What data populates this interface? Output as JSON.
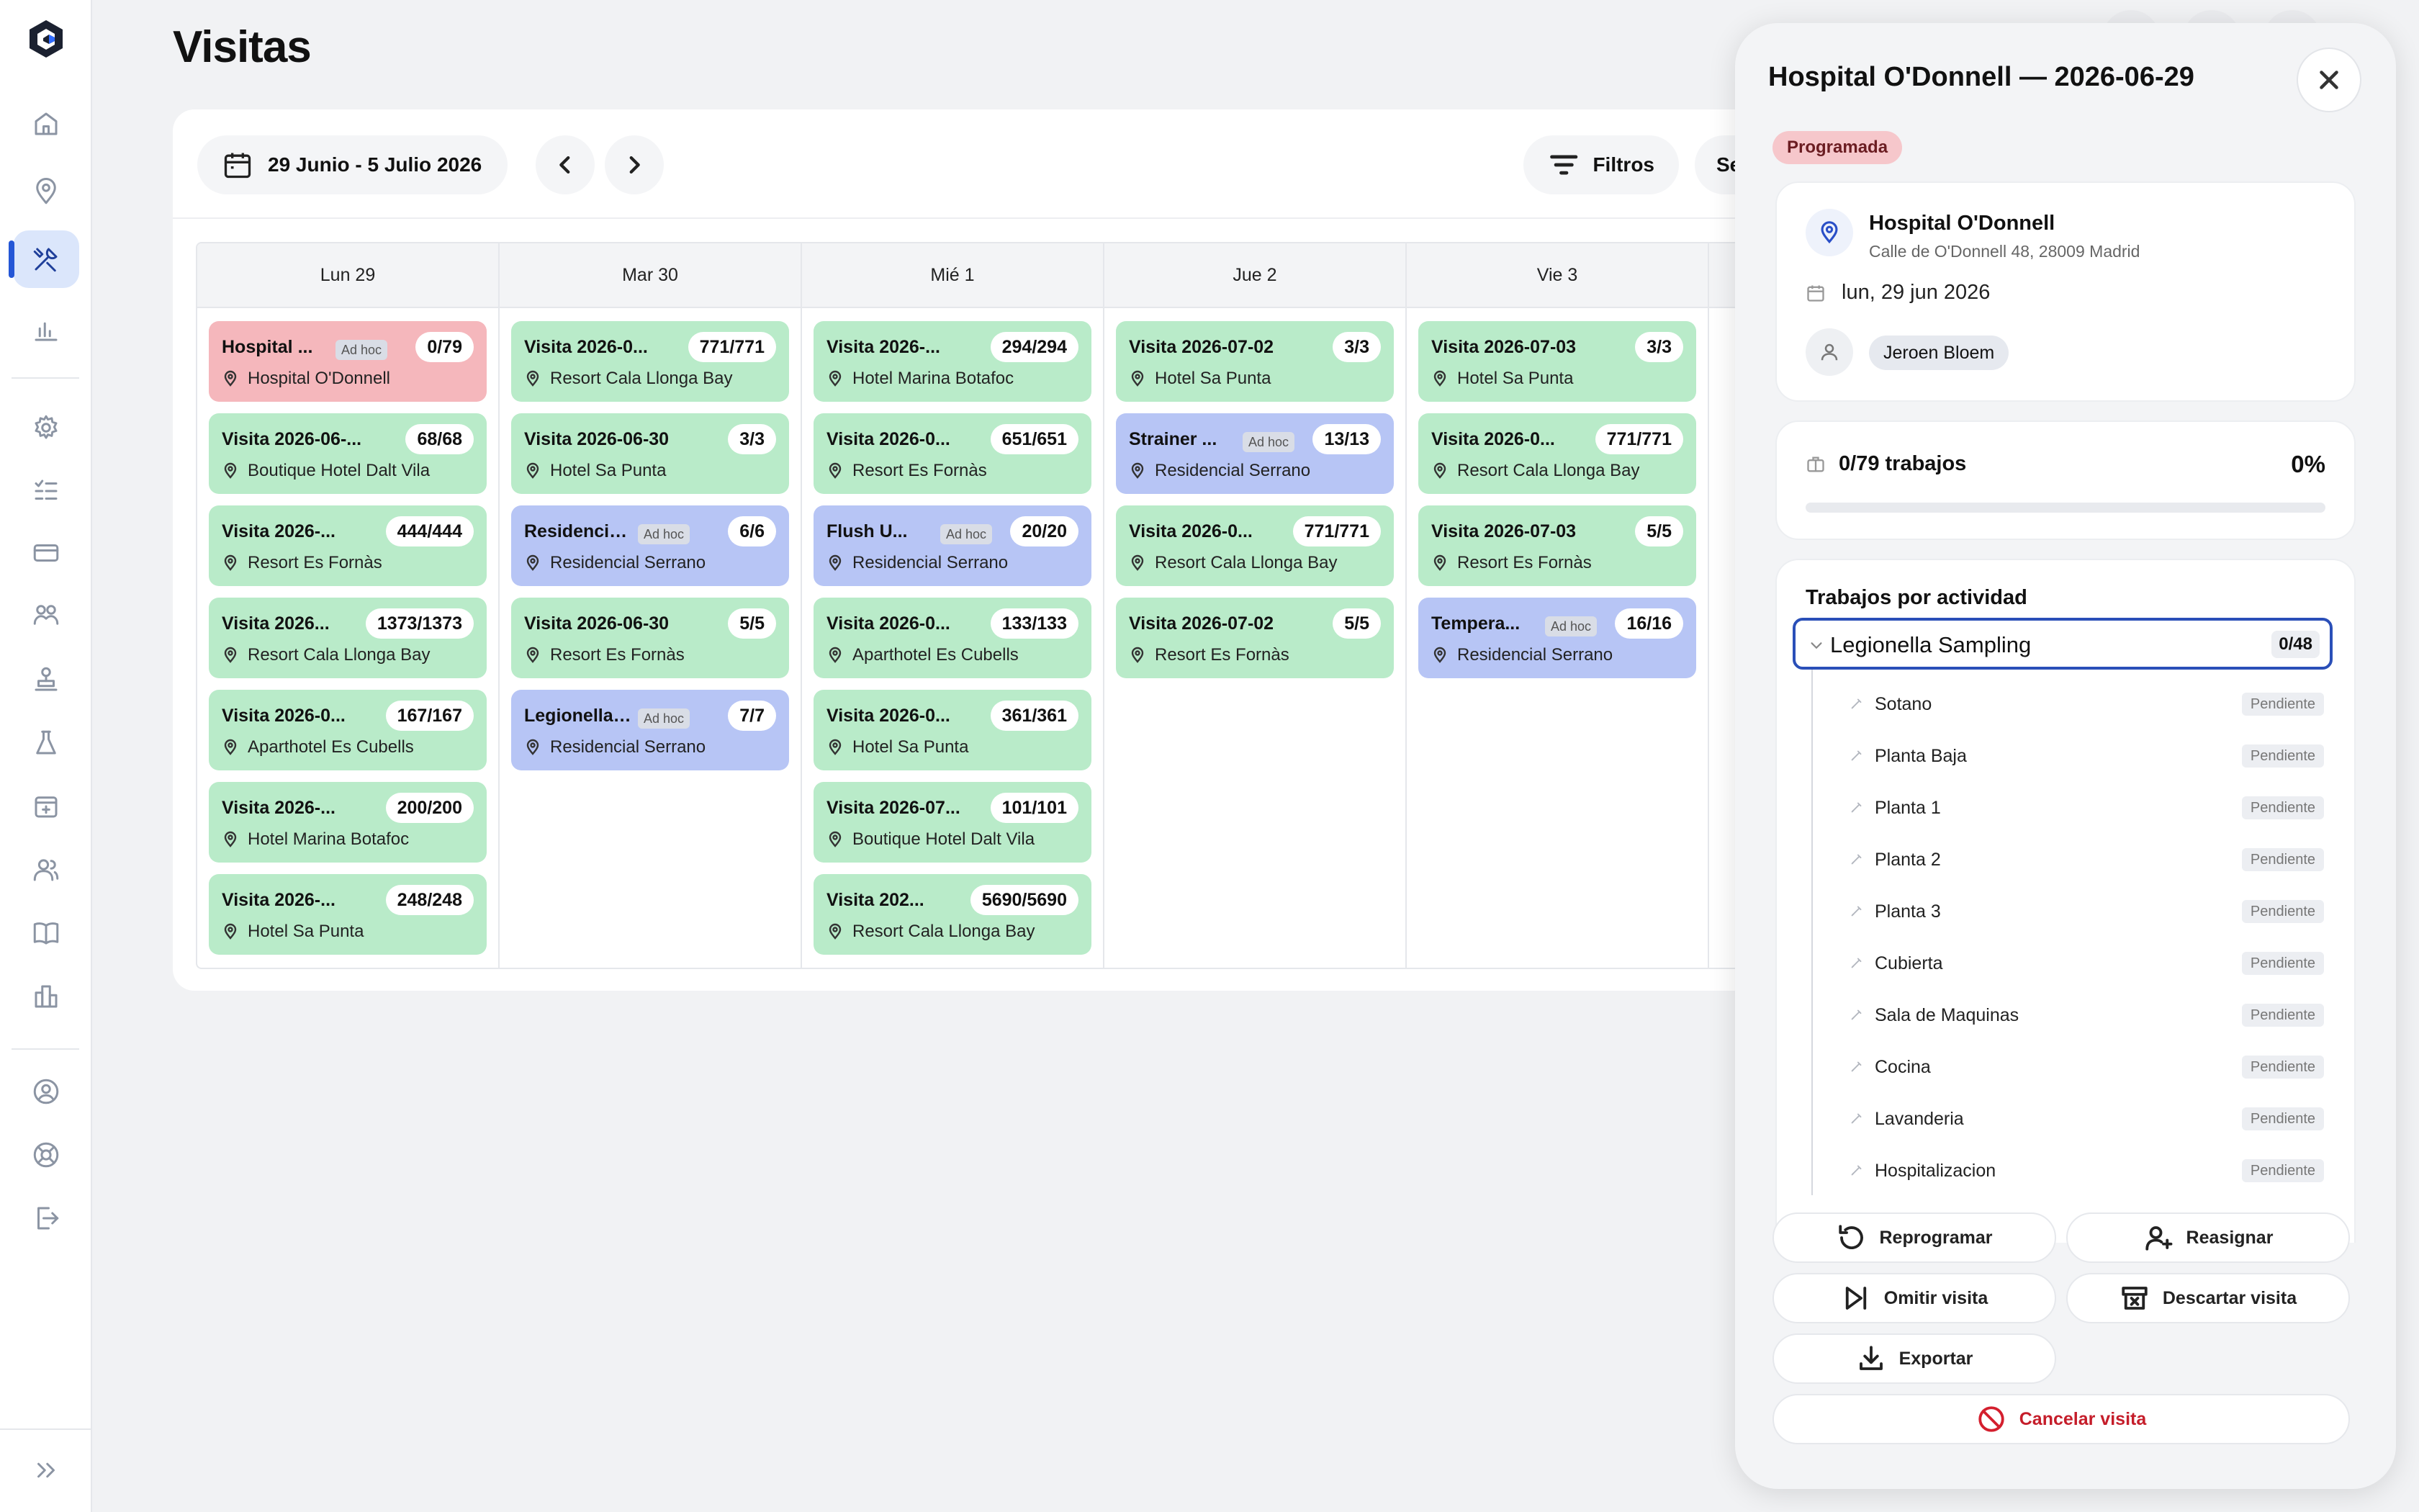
{
  "page": {
    "title": "Visitas"
  },
  "toolbar": {
    "date_range": "29 Junio - 5 Julio 2026",
    "filters_label": "Filtros",
    "extra_label": "Se"
  },
  "colors": {
    "accent": "#2456d6",
    "completed": "#b9ebc9",
    "ad_hoc": "#b7c5f5",
    "overdue": "#f5b7bc",
    "status_badge": "#f6c7cb"
  },
  "days": [
    {
      "label": "Lun 29",
      "cards": [
        {
          "title": "Hospital ...",
          "adhoc": "Ad hoc",
          "count": "0/79",
          "location": "Hospital O'Donnell",
          "color": "red"
        },
        {
          "title": "Visita 2026-06-...",
          "count": "68/68",
          "location": "Boutique Hotel Dalt Vila",
          "color": "green"
        },
        {
          "title": "Visita 2026-...",
          "count": "444/444",
          "location": "Resort Es Fornàs",
          "color": "green"
        },
        {
          "title": "Visita 2026...",
          "count": "1373/1373",
          "location": "Resort Cala Llonga Bay",
          "color": "green"
        },
        {
          "title": "Visita 2026-0...",
          "count": "167/167",
          "location": "Aparthotel Es Cubells",
          "color": "green"
        },
        {
          "title": "Visita 2026-...",
          "count": "200/200",
          "location": "Hotel Marina Botafoc",
          "color": "green"
        },
        {
          "title": "Visita 2026-...",
          "count": "248/248",
          "location": "Hotel Sa Punta",
          "color": "green"
        }
      ]
    },
    {
      "label": "Mar 30",
      "cards": [
        {
          "title": "Visita 2026-0...",
          "count": "771/771",
          "location": "Resort Cala Llonga Bay",
          "color": "green"
        },
        {
          "title": "Visita 2026-06-30",
          "count": "3/3",
          "location": "Hotel Sa Punta",
          "color": "green"
        },
        {
          "title": "Residencia...",
          "adhoc": "Ad hoc",
          "count": "6/6",
          "location": "Residencial Serrano",
          "color": "blue"
        },
        {
          "title": "Visita 2026-06-30",
          "count": "5/5",
          "location": "Resort Es Fornàs",
          "color": "green"
        },
        {
          "title": "Legionella ...",
          "adhoc": "Ad hoc",
          "count": "7/7",
          "location": "Residencial Serrano",
          "color": "blue"
        }
      ]
    },
    {
      "label": "Mié 1",
      "cards": [
        {
          "title": "Visita 2026-...",
          "count": "294/294",
          "location": "Hotel Marina Botafoc",
          "color": "green"
        },
        {
          "title": "Visita 2026-0...",
          "count": "651/651",
          "location": "Resort Es Fornàs",
          "color": "green"
        },
        {
          "title": "Flush U...",
          "adhoc": "Ad hoc",
          "count": "20/20",
          "location": "Residencial Serrano",
          "color": "blue"
        },
        {
          "title": "Visita 2026-0...",
          "count": "133/133",
          "location": "Aparthotel Es Cubells",
          "color": "green"
        },
        {
          "title": "Visita 2026-0...",
          "count": "361/361",
          "location": "Hotel Sa Punta",
          "color": "green"
        },
        {
          "title": "Visita 2026-07...",
          "count": "101/101",
          "location": "Boutique Hotel Dalt Vila",
          "color": "green"
        },
        {
          "title": "Visita 202...",
          "count": "5690/5690",
          "location": "Resort Cala Llonga Bay",
          "color": "green"
        }
      ]
    },
    {
      "label": "Jue 2",
      "cards": [
        {
          "title": "Visita 2026-07-02",
          "count": "3/3",
          "location": "Hotel Sa Punta",
          "color": "green"
        },
        {
          "title": "Strainer ...",
          "adhoc": "Ad hoc",
          "count": "13/13",
          "location": "Residencial Serrano",
          "color": "blue"
        },
        {
          "title": "Visita 2026-0...",
          "count": "771/771",
          "location": "Resort Cala Llonga Bay",
          "color": "green"
        },
        {
          "title": "Visita 2026-07-02",
          "count": "5/5",
          "location": "Resort Es Fornàs",
          "color": "green"
        }
      ]
    },
    {
      "label": "Vie 3",
      "cards": [
        {
          "title": "Visita 2026-07-03",
          "count": "3/3",
          "location": "Hotel Sa Punta",
          "color": "green"
        },
        {
          "title": "Visita 2026-0...",
          "count": "771/771",
          "location": "Resort Cala Llonga Bay",
          "color": "green"
        },
        {
          "title": "Visita 2026-07-03",
          "count": "5/5",
          "location": "Resort Es Fornàs",
          "color": "green"
        },
        {
          "title": "Tempera...",
          "adhoc": "Ad hoc",
          "count": "16/16",
          "location": "Residencial Serrano",
          "color": "blue"
        }
      ]
    },
    {
      "label": "",
      "cards": []
    }
  ],
  "panel": {
    "title": "Hospital O'Donnell — 2026-06-29",
    "status": "Programada",
    "location_name": "Hospital O'Donnell",
    "location_address": "Calle de O'Donnell 48, 28009 Madrid",
    "date": "lun, 29 jun 2026",
    "assignee": "Jeroen Bloem",
    "progress_label": "0/79 trabajos",
    "progress_pct": "0%",
    "progress_value": 0,
    "section_title": "Trabajos por actividad",
    "activity": {
      "label": "Legionella Sampling",
      "count": "0/48"
    },
    "tasks": [
      {
        "name": "Sotano",
        "status": "Pendiente"
      },
      {
        "name": "Planta Baja",
        "status": "Pendiente"
      },
      {
        "name": "Planta 1",
        "status": "Pendiente"
      },
      {
        "name": "Planta 2",
        "status": "Pendiente"
      },
      {
        "name": "Planta 3",
        "status": "Pendiente"
      },
      {
        "name": "Cubierta",
        "status": "Pendiente"
      },
      {
        "name": "Sala de Maquinas",
        "status": "Pendiente"
      },
      {
        "name": "Cocina",
        "status": "Pendiente"
      },
      {
        "name": "Lavanderia",
        "status": "Pendiente"
      },
      {
        "name": "Hospitalizacion",
        "status": "Pendiente"
      }
    ],
    "actions": {
      "reschedule": "Reprogramar",
      "reassign": "Reasignar",
      "skip": "Omitir visita",
      "discard": "Descartar visita",
      "export": "Exportar",
      "cancel": "Cancelar visita"
    }
  }
}
